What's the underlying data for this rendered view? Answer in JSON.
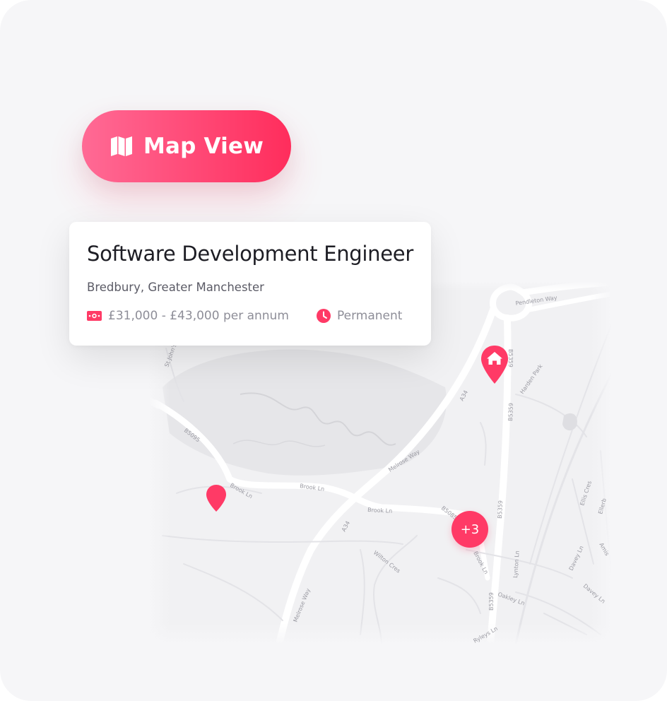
{
  "map_view_button": {
    "label": "Map View",
    "icon": "map-icon"
  },
  "job": {
    "title": "Software Development Engineer",
    "location": "Bredbury, Greater Manchester",
    "salary": "£31,000 - £43,000 per annum",
    "salary_icon": "banknote-icon",
    "employment_type": "Permanent",
    "employment_type_icon": "clock-icon"
  },
  "map": {
    "road_labels": {
      "pendleton_way": "Pendleton Way",
      "b5359_a": "B5359",
      "b5359_b": "B5359",
      "b5359_c": "B5359",
      "b5359_d": "B5359",
      "harden_park": "Harden Park",
      "a34_a": "A34",
      "a34_b": "A34",
      "melrose_way_a": "Melrose Way",
      "melrose_way_b": "Melrose Way",
      "b5095": "B5095",
      "brook_ln_a": "Brook Ln",
      "brook_ln_b": "Brook Ln",
      "brook_ln_c": "Brook Ln",
      "brook_ln_d": "Brook Ln",
      "b5085": "B5085",
      "wilton_cres": "Wilton Cres",
      "lynton_ln": "Lynton Ln",
      "ellis_cres": "Ellis Cres",
      "davey_ln_a": "Davey Ln",
      "davey_ln_b": "Davey Ln",
      "ryleys_ln": "Ryleys Ln",
      "st_johns": "St John's",
      "amis": "Amis",
      "ellerb": "Ellerb",
      "oakley_ln": "Oakley Ln"
    },
    "cluster_count": "+3",
    "marker_color": "#ff3a66"
  }
}
